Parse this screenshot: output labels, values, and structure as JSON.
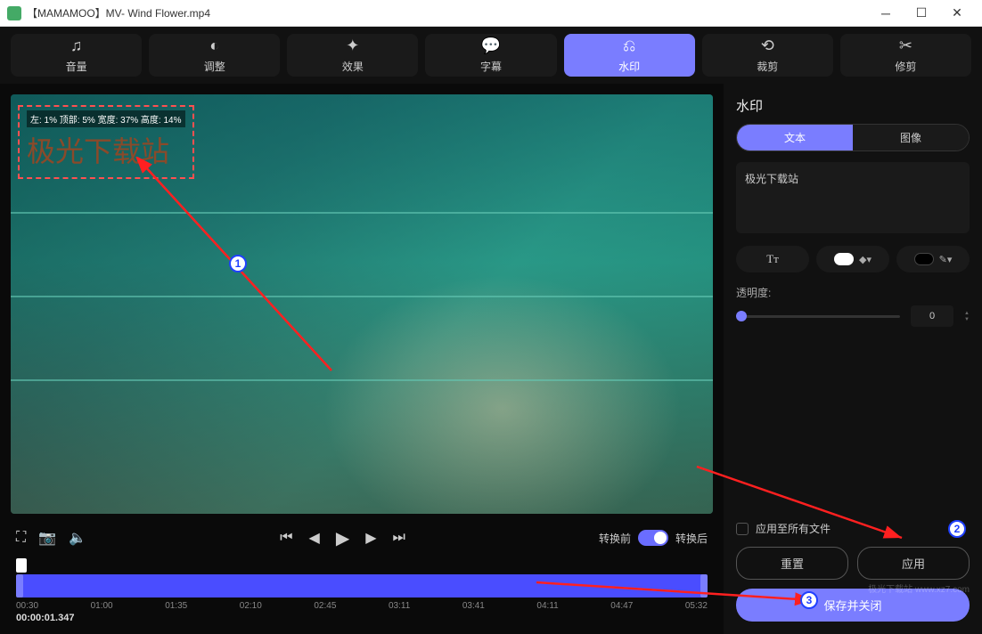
{
  "window": {
    "title": "【MAMAMOO】MV- Wind Flower.mp4"
  },
  "toolbar": {
    "items": [
      {
        "icon": "♫",
        "label": "音量"
      },
      {
        "icon": "◐",
        "label": "调整"
      },
      {
        "icon": "✦",
        "label": "效果"
      },
      {
        "icon": "💬",
        "label": "字幕"
      },
      {
        "icon": "⎌",
        "label": "水印"
      },
      {
        "icon": "⟲",
        "label": "裁剪"
      },
      {
        "icon": "✂",
        "label": "修剪"
      }
    ],
    "active_index": 4
  },
  "watermark_overlay": {
    "info": "左: 1% 顶部: 5% 宽度: 37% 高度: 14%",
    "text": "极光下载站"
  },
  "controls": {
    "before_label": "转换前",
    "after_label": "转换后"
  },
  "timeline": {
    "current": "00:00:01.347",
    "ticks": [
      "00:30",
      "01:00",
      "01:35",
      "02:10",
      "02:45",
      "03:11",
      "03:41",
      "04:11",
      "04:47",
      "05:32"
    ]
  },
  "sidebar": {
    "title": "水印",
    "tab_text": "文本",
    "tab_image": "图像",
    "text_value": "极光下载站",
    "opacity_label": "透明度:",
    "opacity_value": "0",
    "apply_all_label": "应用至所有文件",
    "reset_label": "重置",
    "apply_label": "应用",
    "save_close_label": "保存并关闭"
  },
  "brand": "极光下载站\nwww.xz7.com"
}
